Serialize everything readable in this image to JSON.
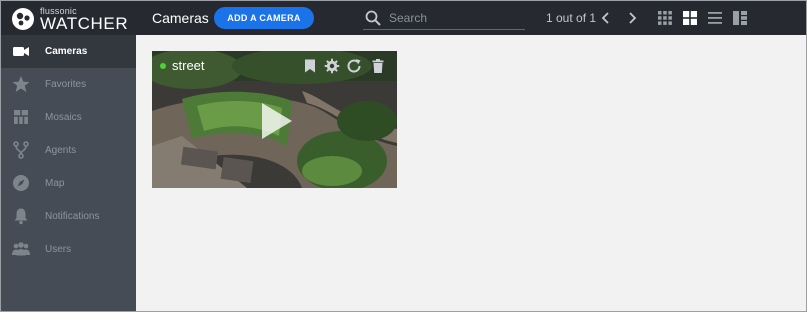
{
  "brand": {
    "small": "flussonic",
    "big": "WATCHER"
  },
  "header": {
    "title": "Cameras",
    "add_button": "ADD A CAMERA",
    "search_placeholder": "Search",
    "pager_text": "1 out of 1"
  },
  "sidebar": {
    "items": [
      {
        "label": "Cameras",
        "icon": "video-camera-icon",
        "active": true
      },
      {
        "label": "Favorites",
        "icon": "star-icon"
      },
      {
        "label": "Mosaics",
        "icon": "mosaic-grid-icon"
      },
      {
        "label": "Agents",
        "icon": "agents-fork-icon"
      },
      {
        "label": "Map",
        "icon": "compass-icon"
      },
      {
        "label": "Notifications",
        "icon": "bell-icon"
      },
      {
        "label": "Users",
        "icon": "users-icon"
      }
    ]
  },
  "cameras": [
    {
      "name": "street",
      "status": "online",
      "status_color": "#4cd137"
    }
  ],
  "colors": {
    "topbar": "#262a30",
    "sidebar": "#464c55",
    "sidebar_active": "#33383f",
    "accent": "#1a73e8",
    "content_bg": "#f2f2f2"
  }
}
